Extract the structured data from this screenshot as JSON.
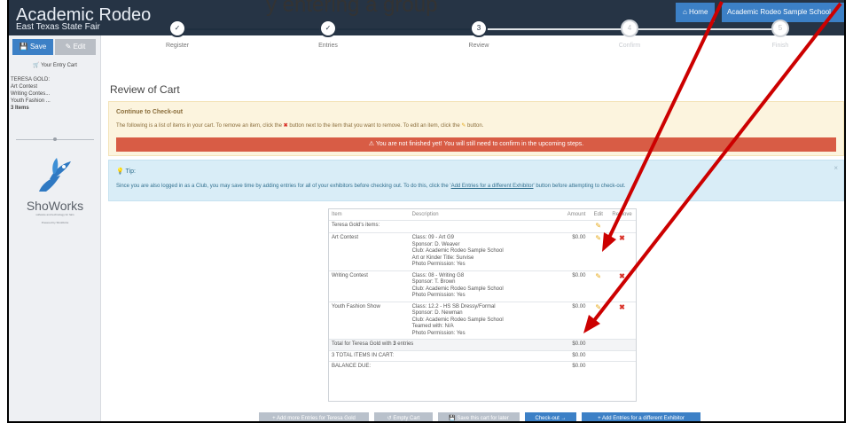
{
  "caption": "y entering a group",
  "header": {
    "title": "Academic Rodeo",
    "subtitle": "East Texas State Fair",
    "home_label": "⌂ Home",
    "user_label": "Academic Rodeo Sample School ▾"
  },
  "sidebar": {
    "save_label": "💾 Save",
    "edit_label": "✎ Edit",
    "cart_label": "🛒 Your Entry Cart",
    "entries": [
      "TERESA GOLD:",
      "Art Contest",
      "Writing Contes...",
      "Youth Fashion ..."
    ],
    "count": "3 Items",
    "logo_text": "ShoWorks",
    "logo_tag": "software and technology for fairs",
    "powered": "Powered by ShoWorks"
  },
  "steps": [
    {
      "label": "Register",
      "mark": "✓",
      "state": "done"
    },
    {
      "label": "Entries",
      "mark": "✓",
      "state": "done"
    },
    {
      "label": "Review",
      "mark": "3",
      "state": "current"
    },
    {
      "label": "Confirm",
      "mark": "4",
      "state": "pending"
    },
    {
      "label": "Finish",
      "mark": "5",
      "state": "pending"
    }
  ],
  "page_title": "Review of Cart",
  "checkout_alert": {
    "heading": "Continue to Check-out",
    "body_part1": "The following is a list of items in your cart. To remove an item, click the ",
    "remove_symbol": "✖",
    "body_part2": " button next to the item that you want to remove. To edit an item, click the ",
    "edit_symbol": "✎",
    "body_part3": " button.",
    "danger": "⚠ You are not finished yet! You will still need to confirm in the upcoming steps."
  },
  "tip": {
    "heading": "💡 Tip:",
    "body_part1": "Since you are also logged in as a Club, you may save time by adding entries for all of your exhibitors before checking out. To do this, click the '",
    "link": "Add Entries for a different Exhibitor",
    "body_part2": "' button before attempting to check-out.",
    "close": "×"
  },
  "cart": {
    "headers": [
      "Item",
      "Description",
      "Amount",
      "Edit",
      "Remove"
    ],
    "group_label": "Teresa Gold's items:",
    "rows": [
      {
        "item": "Art Contest",
        "desc": [
          "Class: 09 - Art G9",
          "Sponsor: D. Weaver",
          "Club: Academic Rodeo Sample School",
          "Art or Kinder Title: Survise",
          "Photo Permission: Yes"
        ],
        "amount": "$0.00"
      },
      {
        "item": "Writing Contest",
        "desc": [
          "Class: 08 - Writing G8",
          "Sponsor: T. Brown",
          "Club: Academic Rodeo Sample School",
          "Photo Permission: Yes"
        ],
        "amount": "$0.00"
      },
      {
        "item": "Youth Fashion Show",
        "desc": [
          "Class: 12.2 - HS SB Dressy/Formal",
          "Sponsor: D. Newman",
          "Club: Academic Rodeo Sample School",
          "Teamed with: N/A",
          "Photo Permission: Yes"
        ],
        "amount": "$0.00"
      }
    ],
    "total_prefix": "Total for Teresa Gold",
    "total_with": " with ",
    "total_count": "3",
    "total_suffix": " entries",
    "total_amount": "$0.00",
    "items_total_label": "3 TOTAL ITEMS IN CART:",
    "items_total_amount": "$0.00",
    "balance_label": "BALANCE DUE:",
    "balance_amount": "$0.00"
  },
  "bottom_buttons": {
    "add_more": "+ Add more Entries for Teresa Gold",
    "empty": "↺ Empty Cart",
    "save_later": "💾 Save this cart for later",
    "checkout": "Check-out →",
    "add_different": "+ Add Entries for a different Exhibitor"
  },
  "colors": {
    "header": "#263445",
    "accent": "#3c80c6",
    "danger": "#d85c45",
    "warning_bg": "#fcf4de",
    "info_bg": "#d9edf7",
    "annotation": "#cc0000"
  }
}
